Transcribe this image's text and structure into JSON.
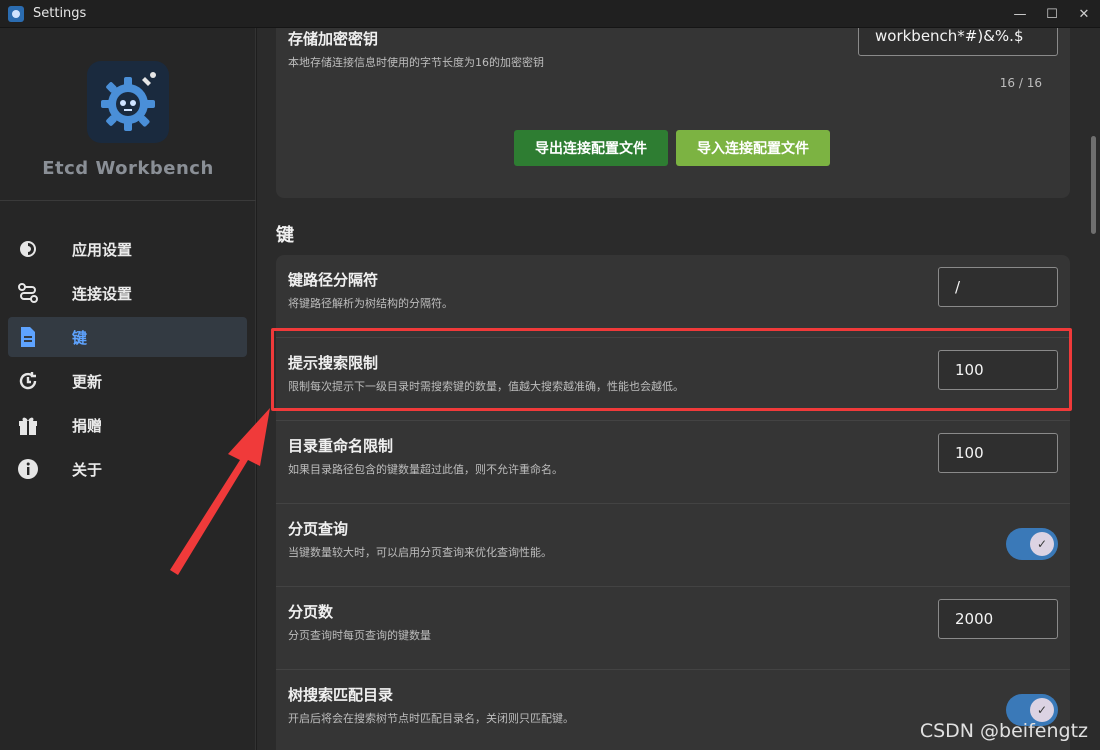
{
  "window": {
    "title": "Settings",
    "minimize": "—",
    "maximize": "☐",
    "close": "✕"
  },
  "sidebar": {
    "brand": "Etcd Workbench",
    "items": [
      {
        "label": "应用设置",
        "icon": "settings-icon"
      },
      {
        "label": "连接设置",
        "icon": "connection-icon"
      },
      {
        "label": "键",
        "icon": "document-icon",
        "active": true
      },
      {
        "label": "更新",
        "icon": "update-icon"
      },
      {
        "label": "捐赠",
        "icon": "gift-icon"
      },
      {
        "label": "关于",
        "icon": "info-icon"
      }
    ]
  },
  "top_card": {
    "title": "存储加密密钥",
    "desc": "本地存储连接信息时使用的字节长度为16的加密密钥",
    "value": "workbench*#)&%.$",
    "counter": "16 / 16",
    "export_label": "导出连接配置文件",
    "import_label": "导入连接配置文件",
    "export_color": "#2e7d32",
    "import_color": "#7cb342"
  },
  "section": {
    "title": "键"
  },
  "rows": [
    {
      "title": "键路径分隔符",
      "desc": "将键路径解析为树结构的分隔符。",
      "value": "/"
    },
    {
      "title": "提示搜索限制",
      "desc": "限制每次提示下一级目录时需搜索键的数量，值越大搜索越准确，性能也会越低。",
      "value": "100"
    },
    {
      "title": "目录重命名限制",
      "desc": "如果目录路径包含的键数量超过此值，则不允许重命名。",
      "value": "100"
    },
    {
      "title": "分页查询",
      "desc": "当键数量较大时，可以启用分页查询来优化查询性能。",
      "toggle": true
    },
    {
      "title": "分页数",
      "desc": "分页查询时每页查询的键数量",
      "value": "2000"
    },
    {
      "title": "树搜索匹配目录",
      "desc": "开启后将会在搜索树节点时匹配目录名，关闭则只匹配键。",
      "toggle": true
    }
  ],
  "colors": {
    "accent": "#5ea3ff",
    "toggle": "#3a79b8",
    "highlight": "#f03a3a"
  },
  "watermark": "CSDN @beifengtz"
}
